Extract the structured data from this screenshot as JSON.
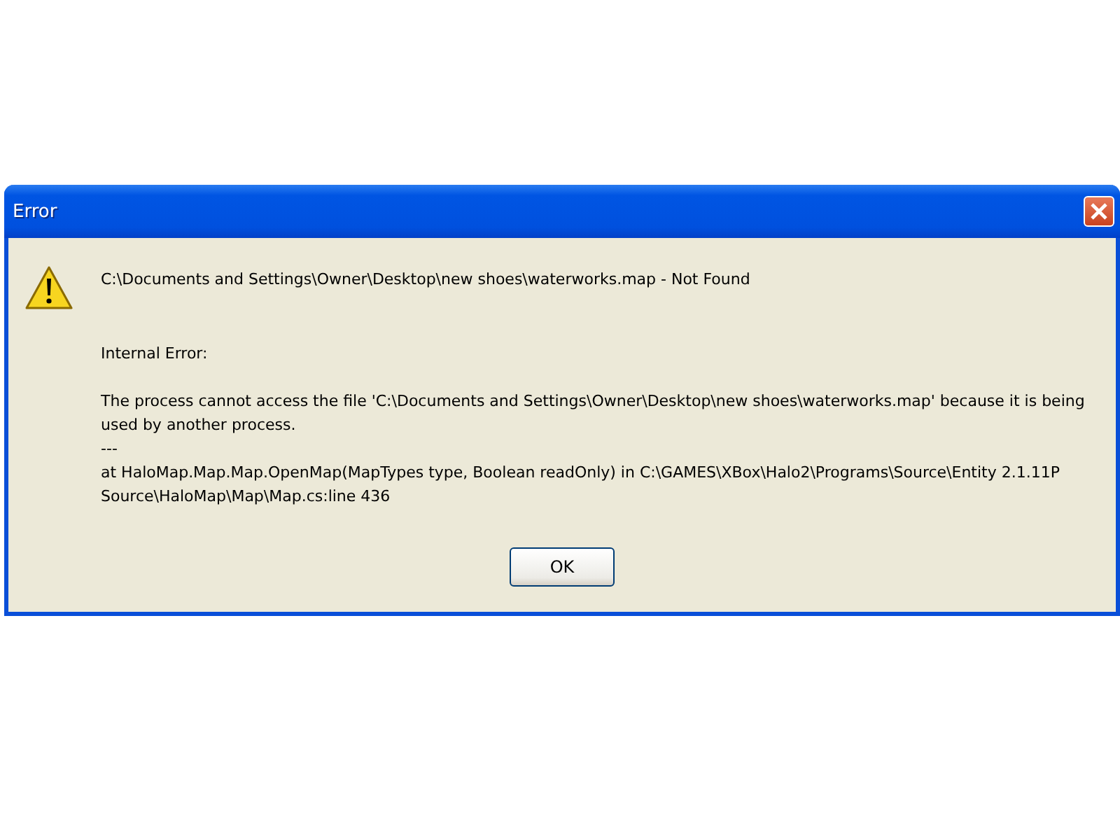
{
  "window": {
    "title": "Error"
  },
  "message": "C:\\Documents and Settings\\Owner\\Desktop\\new shoes\\waterworks.map - Not Found",
  "details": [
    "Internal Error:",
    "The process cannot access the file 'C:\\Documents and Settings\\Owner\\Desktop\\new shoes\\waterworks.map' because it is being used by another process.",
    "---",
    "at HaloMap.Map.Map.OpenMap(MapTypes type, Boolean readOnly) in C:\\GAMES\\XBox\\Halo2\\Programs\\Source\\Entity 2.1.11P Source\\HaloMap\\Map\\Map.cs:line 436"
  ],
  "buttons": [
    "OK"
  ]
}
